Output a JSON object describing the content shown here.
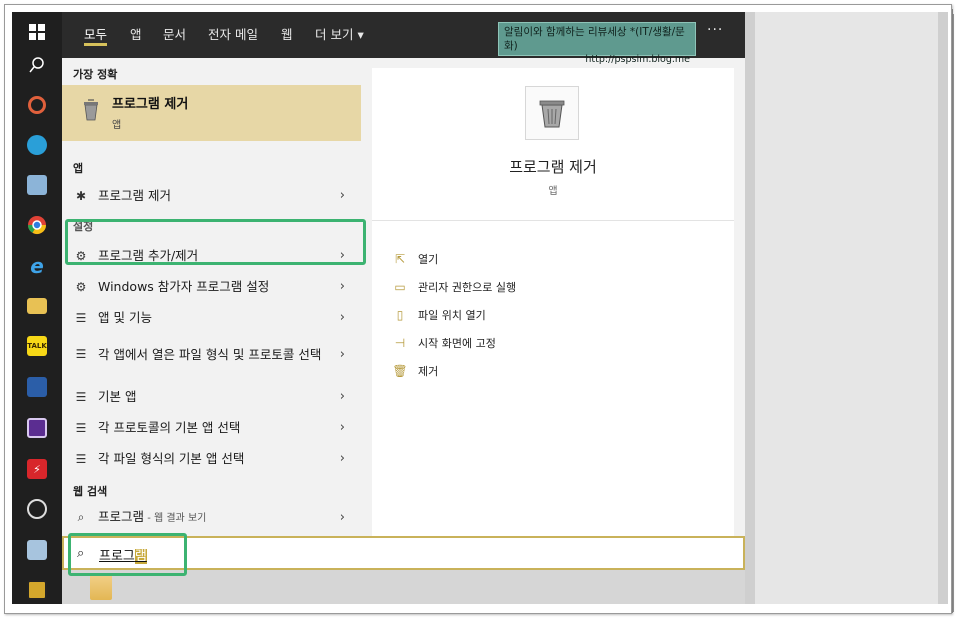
{
  "tabs": [
    "모두",
    "앱",
    "문서",
    "전자 메일",
    "웹",
    "더 보기 ▾"
  ],
  "watermark": {
    "line1": "알림이와 함께하는 리뷰세상 *(IT/생활/문화)",
    "line2": "http://pspsim.blog.me"
  },
  "more_label": "···",
  "best": {
    "header": "가장 정확",
    "title": "프로그램 제거",
    "subtitle": "앱"
  },
  "apps": {
    "header": "앱",
    "items": [
      {
        "label": "프로그램 제거",
        "icon": "uninstall-icon"
      }
    ]
  },
  "settings": {
    "header": "설정",
    "items": [
      {
        "label": "프로그램 추가/제거",
        "icon": "gear-icon"
      },
      {
        "label": "Windows 참가자 프로그램 설정",
        "icon": "gear-icon"
      },
      {
        "label": "앱 및 기능",
        "icon": "list-icon"
      },
      {
        "label": "각 앱에서 열은 파일 형식 및 프로토콜 선택",
        "icon": "list-icon"
      },
      {
        "label": "기본 앱",
        "icon": "list-icon"
      },
      {
        "label": "각 프로토콜의 기본 앱 선택",
        "icon": "list-icon"
      },
      {
        "label": "각 파일 형식의 기본 앱 선택",
        "icon": "list-icon"
      }
    ]
  },
  "web": {
    "header": "웹 검색",
    "query": "프로그램",
    "suffix": " - 웹 결과 보기"
  },
  "preview": {
    "title": "프로그램 제거",
    "subtitle": "앱",
    "actions": [
      {
        "label": "열기",
        "icon": "open-icon"
      },
      {
        "label": "관리자 권한으로 실행",
        "icon": "admin-run-icon"
      },
      {
        "label": "파일 위치 열기",
        "icon": "folder-location-icon"
      },
      {
        "label": "시작 화면에 고정",
        "icon": "pin-icon"
      },
      {
        "label": "제거",
        "icon": "trash-icon"
      }
    ]
  },
  "search": {
    "typed": "프로그",
    "selected": "램"
  },
  "chevron": "›",
  "colors": {
    "highlight_green": "#3cb371",
    "best_bg": "#e7d7a6",
    "accent": "#d6c15b",
    "taskbar": "#1f1f1f"
  }
}
